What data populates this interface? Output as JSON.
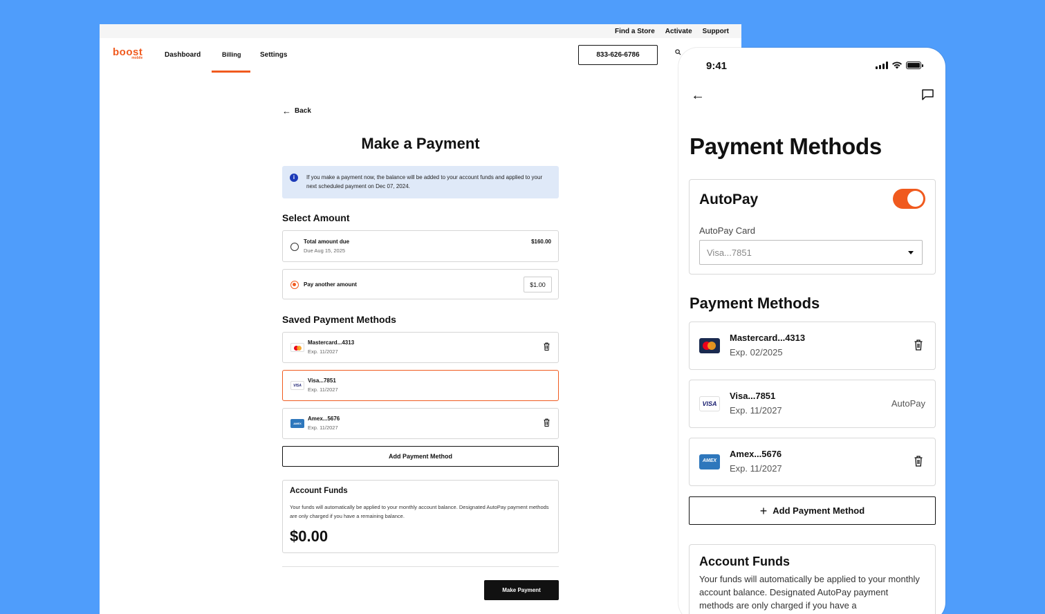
{
  "desktop": {
    "utility_nav": [
      "Find a Store",
      "Activate",
      "Support"
    ],
    "logo": {
      "text": "boost",
      "sub": "mobile"
    },
    "nav": {
      "dashboard": "Dashboard",
      "billing": "Billing",
      "settings": "Settings",
      "active": "Billing"
    },
    "phone_button": "833-626-6786",
    "back_label": "Back",
    "title": "Make a Payment",
    "info_text": "If you make a payment now, the balance will be added to your account funds and applied to your next scheduled payment on Dec 07, 2024.",
    "select_amount": {
      "heading": "Select Amount",
      "options": [
        {
          "label": "Total amount due",
          "sub": "Due Aug 15, 2025",
          "amount": "$160.00",
          "selected": false
        },
        {
          "label": "Pay another amount",
          "amount": "$1.00",
          "selected": true
        }
      ]
    },
    "saved_methods": {
      "heading": "Saved Payment Methods",
      "cards": [
        {
          "name": "Mastercard...4313",
          "exp": "Exp. 11/2027",
          "type": "mastercard",
          "selected": false
        },
        {
          "name": "Visa...7851",
          "exp": "Exp. 11/2027",
          "type": "visa",
          "selected": true
        },
        {
          "name": "Amex...5676",
          "exp": "Exp. 11/2027",
          "type": "amex",
          "selected": false
        }
      ],
      "add_label": "Add Payment Method"
    },
    "account_funds": {
      "heading": "Account Funds",
      "text": "Your funds will automatically be applied to your monthly account balance. Designated AutoPay payment methods are only charged if you have a remaining balance.",
      "value": "$0.00"
    },
    "make_payment": "Make Payment"
  },
  "mobile": {
    "time": "9:41",
    "title": "Payment Methods",
    "autopay": {
      "heading": "AutoPay",
      "enabled": true,
      "card_label": "AutoPay Card",
      "card_value": "Visa...7851"
    },
    "methods_heading": "Payment Methods",
    "cards": [
      {
        "name": "Mastercard...4313",
        "exp": "Exp. 02/2025",
        "type": "mastercard",
        "tag": ""
      },
      {
        "name": "Visa...7851",
        "exp": "Exp. 11/2027",
        "type": "visa",
        "tag": "AutoPay"
      },
      {
        "name": "Amex...5676",
        "exp": "Exp. 11/2027",
        "type": "amex",
        "tag": ""
      }
    ],
    "add_label": "Add Payment Method",
    "account_funds": {
      "heading": "Account Funds",
      "text": "Your funds will automatically be applied to your monthly account balance. Designated AutoPay payment methods are only charged if you have a"
    }
  },
  "colors": {
    "background": "#4f9dfb",
    "brand": "#f05a1e",
    "info_bg": "#dfe9f8",
    "button_dark": "#111111"
  },
  "icons": [
    "back-arrow-icon",
    "search-icon",
    "info-icon",
    "trash-icon",
    "chat-icon",
    "mastercard-icon",
    "visa-icon",
    "amex-icon",
    "plus-icon",
    "chevron-down-icon",
    "signal-icon",
    "wifi-icon",
    "battery-icon"
  ]
}
